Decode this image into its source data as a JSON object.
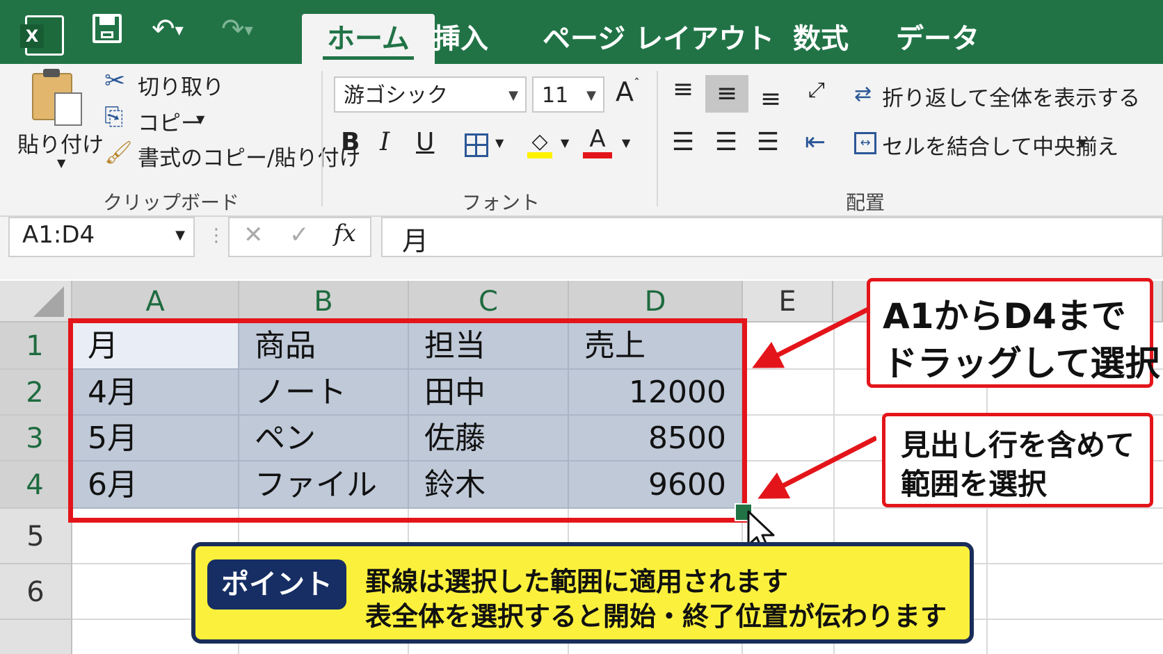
{
  "quick_access": {
    "excel_icon": "excel-icon",
    "save_icon": "save-icon",
    "undo_icon": "undo-icon",
    "redo_icon": "redo-icon"
  },
  "tabs": [
    {
      "label": "ホーム",
      "active": true
    },
    {
      "label": "挿入"
    },
    {
      "label": "ページ レイアウト"
    },
    {
      "label": "数式"
    },
    {
      "label": "データ"
    }
  ],
  "clipboard": {
    "paste_label": "貼り付け",
    "cut_label": "切り取り",
    "copy_label": "コピー",
    "format_painter_label": "書式のコピー/貼り付け",
    "group_label": "クリップボード"
  },
  "font": {
    "font_name": "游ゴシック",
    "font_size": "11",
    "bold": "B",
    "italic": "I",
    "underline": "U",
    "font_color_glyph": "A",
    "group_label": "フォント"
  },
  "alignment": {
    "wrap_text_label": "折り返して全体を表示する",
    "merge_center_label": "セルを結合して中央揃え",
    "group_label": "配置"
  },
  "formula_bar": {
    "name_box": "A1:D4",
    "fx": "fx",
    "content": "月"
  },
  "columns": [
    "A",
    "B",
    "C",
    "D",
    "E"
  ],
  "rows": [
    "1",
    "2",
    "3",
    "4",
    "5",
    "6"
  ],
  "table": [
    [
      "月",
      "商品",
      "担当",
      "売上"
    ],
    [
      "4月",
      "ノート",
      "田中",
      "12000"
    ],
    [
      "5月",
      "ペン",
      "佐藤",
      "8500"
    ],
    [
      "6月",
      "ファイル",
      "鈴木",
      "9600"
    ]
  ],
  "callouts": {
    "drag_line1": "A1からD4まで",
    "drag_line2": "ドラッグして選択",
    "header_line1": "見出し行を含めて",
    "header_line2": "範囲を選択"
  },
  "point": {
    "badge": "ポイント",
    "line1": "罫線は選択した範囲に適用されます",
    "line2": "表全体を選択すると開始・終了位置が伝わります"
  },
  "colors": {
    "excel_green": "#217346",
    "selection_fill": "#bfc9d8",
    "callout_red": "#e3151a",
    "point_yellow": "#fbf13c",
    "point_navy": "#162e63"
  }
}
